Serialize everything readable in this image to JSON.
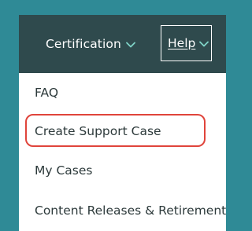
{
  "colors": {
    "background": "#2f8a96",
    "topbar": "#2f4a4d",
    "highlight_border": "#e0443b",
    "menu_text": "#2d3a3b"
  },
  "topbar": {
    "certification_label": "Certification",
    "certification_icon": "chevron-down-icon",
    "help_label": "Help",
    "help_icon": "chevron-down-icon"
  },
  "menu": {
    "items": [
      {
        "label": "FAQ"
      },
      {
        "label": "Create Support Case",
        "highlighted": true
      },
      {
        "label": "My Cases"
      },
      {
        "label": "Content Releases & Retirements"
      }
    ]
  }
}
